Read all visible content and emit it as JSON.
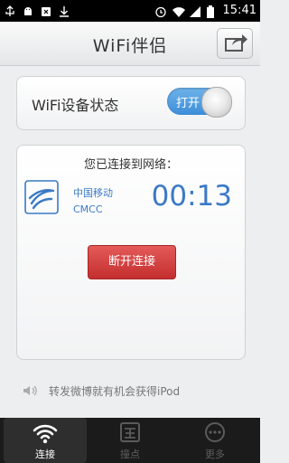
{
  "status_bar": {
    "time": "15:41",
    "icons": [
      "usb-icon",
      "android-icon",
      "usb-debug-icon",
      "download-icon",
      "alarm-icon",
      "wifi-signal-icon",
      "signal-icon",
      "battery-icon"
    ]
  },
  "header": {
    "title": "WiFi伴侣",
    "share_icon": "share-icon"
  },
  "wifi_status": {
    "label": "WiFi设备状态",
    "toggle_label": "打开",
    "accent": "#3d8dd8"
  },
  "connection": {
    "title": "您已连接到网络：",
    "carrier_name": "中国移动",
    "ssid": "CMCC",
    "duration": "00:13",
    "disconnect_label": "断开连接",
    "disconnect_color": "#c42e2e",
    "accent": "#3a7ac6"
  },
  "promo": {
    "icon": "speaker-icon",
    "text": "转发微博就有机会获得iPod"
  },
  "bottom_nav": {
    "items": [
      {
        "label": "连接",
        "icon": "wifi-icon",
        "active": true
      },
      {
        "label": "撞点",
        "icon": "map-icon",
        "active": false
      },
      {
        "label": "更多",
        "icon": "more-icon",
        "active": false
      }
    ]
  }
}
